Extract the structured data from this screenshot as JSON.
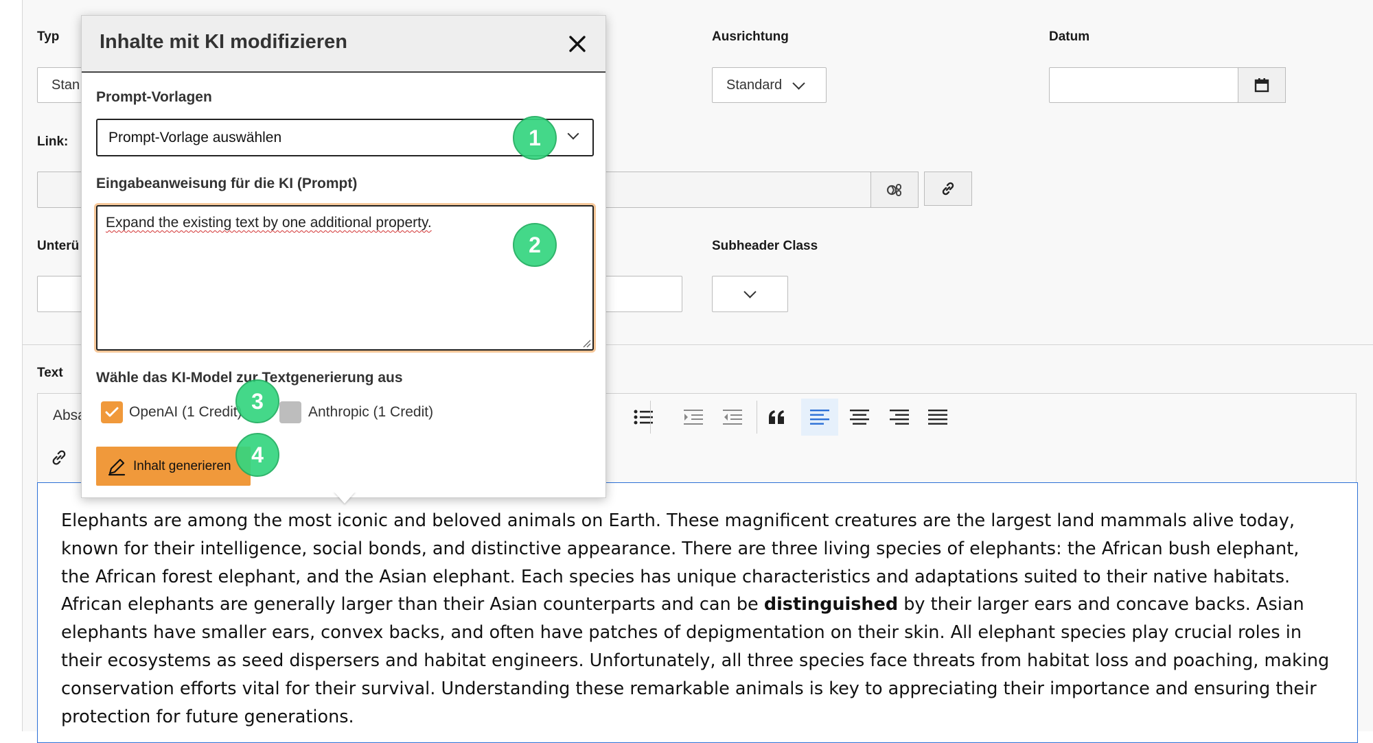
{
  "form": {
    "typ_label": "Typ",
    "typ_value": "Stan",
    "ausrichtung_label": "Ausrichtung",
    "ausrichtung_value": "Standard",
    "datum_label": "Datum",
    "link_label": "Link:",
    "unter_label": "Unterü",
    "subheader_class_label": "Subheader Class",
    "text_label": "Text",
    "toolbar_block_value": "Absa"
  },
  "popover": {
    "title": "Inhalte mit KI modifizieren",
    "prompt_templates_label": "Prompt-Vorlagen",
    "prompt_template_value": "Prompt-Vorlage auswählen",
    "prompt_label": "Eingabeanweisung für die KI (Prompt)",
    "prompt_value": "Expand the existing text by one additional property.",
    "model_label": "Wähle das KI-Model zur Textgenerierung aus",
    "models": [
      {
        "label": "OpenAI (1 Credit)",
        "checked": true
      },
      {
        "label": "Anthropic (1 Credit)",
        "checked": false
      }
    ],
    "generate_button": "Inhalt generieren"
  },
  "markers": [
    "1",
    "2",
    "3",
    "4"
  ],
  "editor": {
    "text_before_bold": "Elephants are among the most iconic and beloved animals on Earth. These magnificent creatures are the largest land mammals alive today, known for their intelligence, social bonds, and distinctive appearance. There are three living species of elephants: the African bush elephant, the African forest elephant, and the Asian elephant. Each species has unique characteristics and adaptations suited to their native habitats. African elephants are generally larger than their Asian counterparts and can be ",
    "bold_text": "distinguished",
    "text_after_bold": " by their larger ears and concave backs. Asian elephants have smaller ears, convex backs, and often have patches of depigmentation on their skin. All elephant species play crucial roles in their ecosystems as seed dispersers and habitat engineers. Unfortunately, all three species face threats from habitat loss and poaching, making conservation efforts vital for their survival. Understanding these remarkable animals is key to appreciating their importance and ensuring their protection for future generations."
  },
  "colors": {
    "marker_green": "#35d57f",
    "generate_orange": "#f0993b",
    "checkbox_orange": "#f0993b",
    "editor_focus_blue": "#2b6fd6",
    "active_align_bg": "#e6f0fb"
  },
  "icons": [
    "close-icon",
    "chevron-down-icon",
    "calendar-icon",
    "link-browse-icon",
    "link-icon",
    "bullet-list-icon",
    "indent-icon",
    "outdent-icon",
    "blockquote-icon",
    "align-left-icon",
    "align-center-icon",
    "align-right-icon",
    "align-justify-icon",
    "check-icon",
    "pencil-icon"
  ]
}
